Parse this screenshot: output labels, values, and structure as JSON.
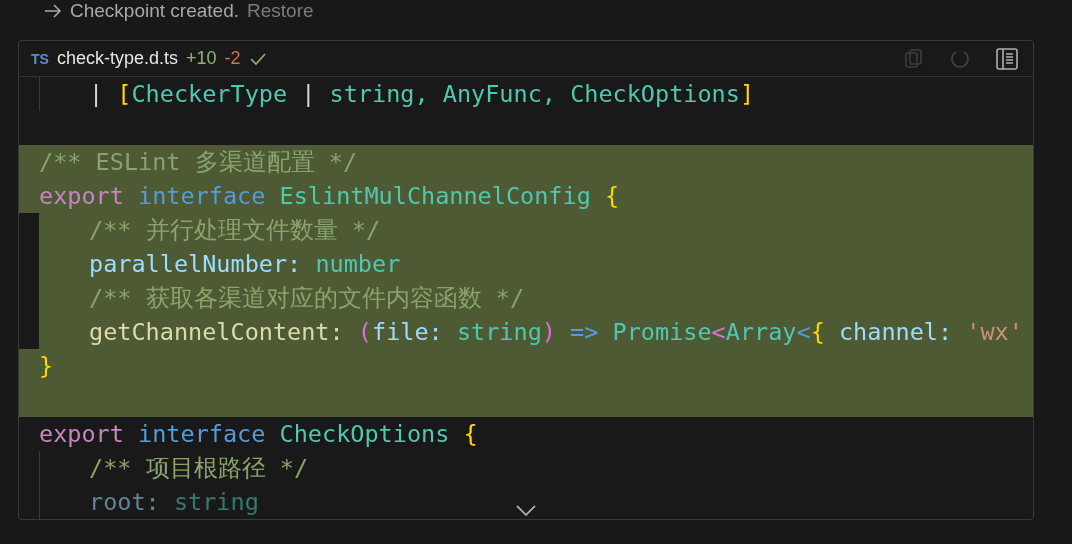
{
  "checkpoint": {
    "text": "Checkpoint created.",
    "link": "Restore"
  },
  "file": {
    "lang": "TS",
    "name": "check-type.d.ts",
    "added": "+10",
    "removed": "-2",
    "applied": true
  },
  "toolbar": [
    {
      "kind": "copy",
      "disabled": true
    },
    {
      "kind": "undo",
      "disabled": true
    },
    {
      "kind": "panel",
      "disabled": false
    }
  ],
  "code": [
    {
      "kind": "group",
      "children": [
        {
          "kind": "code",
          "added": false,
          "words": [
            [
              {
                "text": "|",
                "kind": "punct"
              }
            ],
            [
              {
                "text": "[",
                "kind": "bracket1"
              },
              {
                "text": "CheckerType",
                "kind": "type"
              }
            ],
            [
              {
                "text": "|",
                "kind": "punct"
              }
            ],
            [
              {
                "text": "string,",
                "kind": "type"
              }
            ],
            [
              {
                "text": "AnyFunc,",
                "kind": "type"
              }
            ],
            [
              {
                "text": "CheckOptions",
                "kind": "type"
              },
              {
                "text": "]",
                "kind": "bracket1"
              }
            ]
          ]
        }
      ]
    },
    {
      "kind": "blank"
    },
    {
      "kind": "code",
      "added": true,
      "words": [
        [
          {
            "text": "/** ESLint 多渠道配置 */",
            "kind": "comment"
          }
        ]
      ]
    },
    {
      "kind": "code",
      "added": true,
      "words": [
        [
          {
            "text": "export",
            "kind": "keyword"
          }
        ],
        [
          {
            "text": "interface",
            "kind": "storage"
          }
        ],
        [
          {
            "text": "EslintMulChannelConfig",
            "kind": "type"
          }
        ],
        [
          {
            "text": "{",
            "kind": "bracket1"
          }
        ]
      ],
      "children": [
        {
          "kind": "code",
          "added": true,
          "words": [
            [
              {
                "text": "/** 并行处理文件数量 */",
                "kind": "comment"
              }
            ]
          ]
        },
        {
          "kind": "code",
          "added": true,
          "words": [
            [
              {
                "text": "parallelNumber:",
                "kind": "property"
              }
            ],
            [
              {
                "text": "number",
                "kind": "type"
              }
            ]
          ]
        },
        {
          "kind": "code",
          "added": true,
          "words": [
            [
              {
                "text": "/** 获取各渠道对应的文件内容函数 */",
                "kind": "comment"
              }
            ]
          ]
        },
        {
          "kind": "code",
          "added": true,
          "words": [
            [
              {
                "text": "getChannelContent:",
                "kind": "function"
              }
            ],
            [
              {
                "text": "(",
                "kind": "bracket2"
              },
              {
                "text": "file:",
                "kind": "property"
              }
            ],
            [
              {
                "text": "string",
                "kind": "type"
              },
              {
                "text": ")",
                "kind": "bracket2"
              }
            ],
            [
              {
                "text": "=>",
                "kind": "storage"
              }
            ],
            [
              {
                "text": "Promise",
                "kind": "type"
              },
              {
                "text": "<",
                "kind": "bracket2"
              },
              {
                "text": "Array",
                "kind": "type"
              },
              {
                "text": "<",
                "kind": "storage"
              },
              {
                "text": "{",
                "kind": "bracket1"
              }
            ],
            [
              {
                "text": "channel:",
                "kind": "property"
              }
            ],
            [
              {
                "text": "'wx'",
                "kind": "string"
              }
            ]
          ]
        }
      ]
    },
    {
      "kind": "code",
      "added": true,
      "words": [
        [
          {
            "text": "}",
            "kind": "bracket1"
          }
        ]
      ]
    },
    {
      "kind": "blank",
      "added": true
    },
    {
      "kind": "code",
      "added": false,
      "words": [
        [
          {
            "text": "export",
            "kind": "keyword"
          }
        ],
        [
          {
            "text": "interface",
            "kind": "storage"
          }
        ],
        [
          {
            "text": "CheckOptions",
            "kind": "type"
          }
        ],
        [
          {
            "text": "{",
            "kind": "bracket1"
          }
        ]
      ],
      "children": [
        {
          "kind": "code",
          "added": false,
          "words": [
            [
              {
                "text": "/** 项目根路径 */",
                "kind": "comment"
              }
            ]
          ]
        },
        {
          "kind": "code",
          "added": false,
          "faded": true,
          "words": [
            [
              {
                "text": "root:",
                "kind": "property"
              }
            ],
            [
              {
                "text": "string",
                "kind": "type"
              }
            ]
          ]
        }
      ]
    }
  ]
}
